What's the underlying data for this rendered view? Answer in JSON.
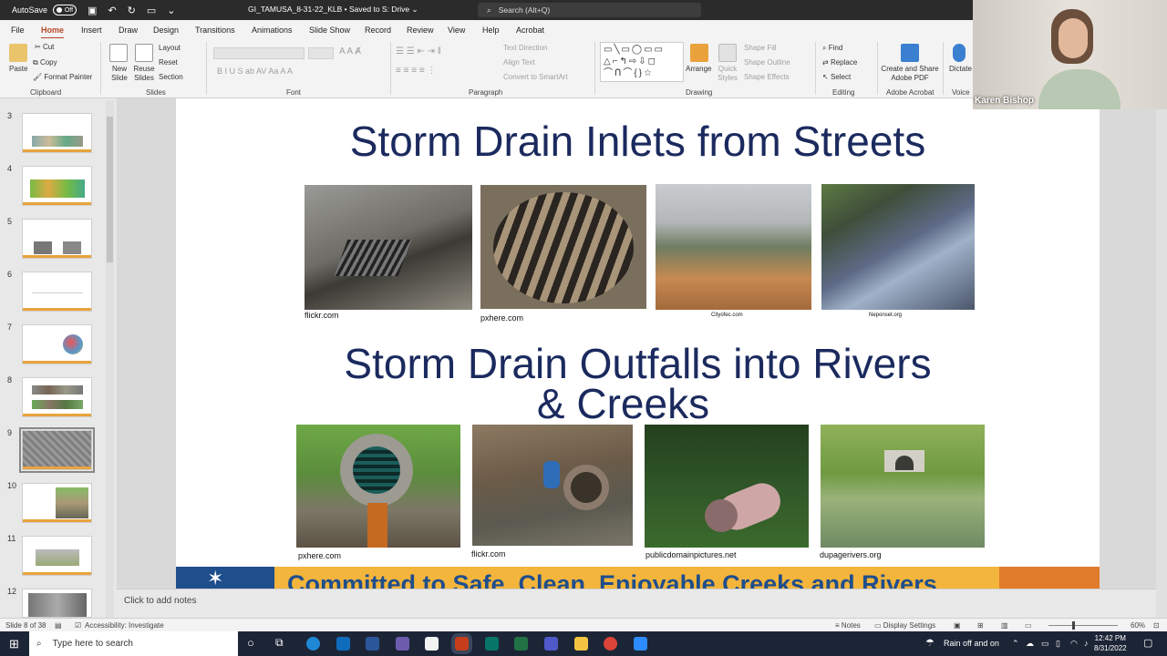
{
  "titlebar": {
    "autosave_label": "AutoSave",
    "autosave_state": "Off",
    "document_title": "GI_TAMUSA_8-31-22_KLB • Saved to S: Drive ⌄",
    "search_placeholder": "Search (Alt+Q)"
  },
  "menu_tabs": [
    "File",
    "Home",
    "Insert",
    "Draw",
    "Design",
    "Transitions",
    "Animations",
    "Slide Show",
    "Record",
    "Review",
    "View",
    "Help",
    "Acrobat"
  ],
  "ribbon": {
    "clipboard": {
      "paste": "Paste",
      "cut": "Cut",
      "copy": "Copy",
      "format_painter": "Format Painter",
      "group": "Clipboard"
    },
    "slides": {
      "new_slide": "New Slide",
      "reuse_slides": "Reuse Slides",
      "layout": "Layout",
      "reset": "Reset",
      "section": "Section",
      "group": "Slides"
    },
    "font": {
      "group": "Font"
    },
    "paragraph": {
      "text_direction": "Text Direction",
      "align_text": "Align Text",
      "smartart": "Convert to SmartArt",
      "group": "Paragraph"
    },
    "drawing": {
      "arrange": "Arrange",
      "quick_styles": "Quick Styles",
      "shape_fill": "Shape Fill",
      "shape_outline": "Shape Outline",
      "shape_effects": "Shape Effects",
      "group": "Drawing"
    },
    "editing": {
      "find": "Find",
      "replace": "Replace",
      "select": "Select",
      "group": "Editing"
    },
    "acrobat": {
      "create_share": "Create and Share Adobe PDF",
      "group": "Adobe Acrobat"
    },
    "voice": {
      "dictate": "Dictate",
      "group": "Voice"
    }
  },
  "thumbnails": [
    {
      "num": "3"
    },
    {
      "num": "4"
    },
    {
      "num": "5"
    },
    {
      "num": "6"
    },
    {
      "num": "7"
    },
    {
      "num": "8"
    },
    {
      "num": "9"
    },
    {
      "num": "10"
    },
    {
      "num": "11"
    },
    {
      "num": "12"
    }
  ],
  "slide": {
    "title1": "Storm Drain Inlets from Streets",
    "title2_line1": "Storm Drain Outfalls into Rivers",
    "title2_line2": "& Creeks",
    "top_credits": [
      "flickr.com",
      "pxhere.com",
      "Cityofec.com",
      "Neponset.org"
    ],
    "bottom_credits": [
      "pxhere.com",
      "flickr.com",
      "publicdomainpictures.net",
      "dupagerivers.org"
    ],
    "banner_text": "Committed to Safe, Clean, Enjoyable Creeks and Rivers"
  },
  "notes_placeholder": "Click to add notes",
  "statusbar": {
    "slide_count": "Slide 8 of 38",
    "accessibility": "Accessibility: Investigate",
    "notes": "Notes",
    "display_settings": "Display Settings",
    "zoom": "60%"
  },
  "taskbar": {
    "search_placeholder": "Type here to search",
    "weather": "Rain off and on",
    "time": "12:42 PM",
    "date": "8/31/2022"
  },
  "webcam": {
    "name": "Karen Bishop"
  }
}
